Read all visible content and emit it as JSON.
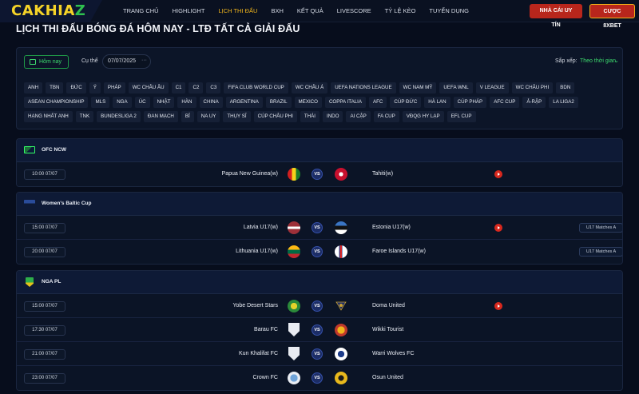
{
  "header": {
    "logo_part1": "CAKHIA",
    "logo_part2": "Z",
    "nav": [
      {
        "label": "TRANG CHỦ",
        "active": false
      },
      {
        "label": "HIGHLIGHT",
        "active": false
      },
      {
        "label": "LỊCH THI ĐẤU",
        "active": true
      },
      {
        "label": "BXH",
        "active": false
      },
      {
        "label": "KẾT QUẢ",
        "active": false
      },
      {
        "label": "LIVESCORE",
        "active": false
      },
      {
        "label": "TỶ LỆ KÈO",
        "active": false
      },
      {
        "label": "TUYỂN DỤNG",
        "active": false
      }
    ],
    "btn_nha_cai": "NHÀ CÁI UY TÍN",
    "btn_cuoc": "CƯỢC 8XBET"
  },
  "page_title": "LỊCH THI ĐẤU BÓNG ĐÁ HÔM NAY - LTĐ TẤT CẢ GIẢI ĐẤU",
  "filters": {
    "today_label": "Hôm nay",
    "specific_label": "Cụ thể",
    "date_value": "07/07/2025",
    "sort_label": "Sắp xếp:",
    "sort_value": "Theo thời gian",
    "tags": [
      "ANH",
      "TBN",
      "ĐỨC",
      "Ý",
      "PHÁP",
      "WC CHÂU ÂU",
      "C1",
      "C2",
      "C3",
      "FIFA CLUB WORLD CUP",
      "WC CHÂU Á",
      "UEFA NATIONS LEAGUE",
      "WC NAM MỸ",
      "UEFA WNL",
      "V LEAGUE",
      "WC CHÂU PHI",
      "BDN",
      "ASEAN CHAMPIONSHIP",
      "MLS",
      "NGA",
      "ÚC",
      "NHẬT",
      "HÀN",
      "CHINA",
      "ARGENTINA",
      "BRAZIL",
      "MEXICO",
      "COPPA ITALIA",
      "AFC",
      "CÚP ĐỨC",
      "HÀ LAN",
      "CÚP PHÁP",
      "AFC CUP",
      "Ả-RẬP",
      "LA LIGA2",
      "HẠNG NHẤT ANH",
      "TNK",
      "BUNDESLIGA 2",
      "ĐAN MẠCH",
      "BỈ",
      "NA UY",
      "THỤY SĨ",
      "CÚP CHÂU PHI",
      "THÁI",
      "INDO",
      "AI CẬP",
      "FA CUP",
      "VĐQG HY LẠP",
      "EFL CUP"
    ]
  },
  "leagues": [
    {
      "name": "OFC NCW",
      "matches": [
        {
          "time": "10:00 07/07",
          "home": "Papua New Guinea(w)",
          "away": "Tahiti(w)",
          "vs": "VS",
          "live": true,
          "badge": ""
        }
      ]
    },
    {
      "name": "Women's Baltic Cup",
      "matches": [
        {
          "time": "15:00 07/07",
          "home": "Latvia U17(w)",
          "away": "Estonia U17(w)",
          "vs": "VS",
          "live": true,
          "badge": "U17 Matches A"
        },
        {
          "time": "20:00 07/07",
          "home": "Lithuania U17(w)",
          "away": "Faroe Islands U17(w)",
          "vs": "VS",
          "live": false,
          "badge": "U17 Matches A"
        }
      ]
    },
    {
      "name": "NGA PL",
      "matches": [
        {
          "time": "15:00 07/07",
          "home": "Yobe Desert Stars",
          "away": "Doma United",
          "vs": "VS",
          "live": true,
          "badge": ""
        },
        {
          "time": "17:30 07/07",
          "home": "Barau FC",
          "away": "Wikki Tourist",
          "vs": "VS",
          "live": false,
          "badge": ""
        },
        {
          "time": "21:00 07/07",
          "home": "Kun Khalifat FC",
          "away": "Warri Wolves FC",
          "vs": "VS",
          "live": false,
          "badge": ""
        },
        {
          "time": "23:00 07/07",
          "home": "Crown FC",
          "away": "Osun United",
          "vs": "VS",
          "live": false,
          "badge": ""
        }
      ]
    }
  ],
  "colors": {
    "accent_yellow": "#f0b51c",
    "accent_green": "#3ddc6e",
    "brand_red": "#b8261c",
    "bg": "#070d1c"
  }
}
